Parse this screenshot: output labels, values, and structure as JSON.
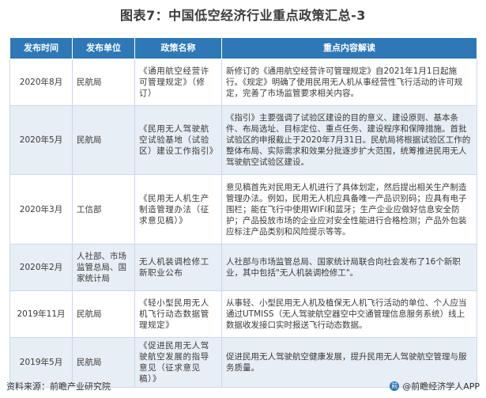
{
  "title": "图表7：中国低空经济行业重点政策汇总-3",
  "table": {
    "headers": [
      "发布时间",
      "发布单位",
      "政策名称",
      "重点内容解读"
    ],
    "rows": [
      {
        "date": "2020年8月",
        "unit": "民航局",
        "name": "《通用航空经营许可管理规定》（修订）",
        "content": "新修订的《通用航空经营许可管理规定》自2021年1月1日起施行。《规定》明确了使用民用无人机从事经营性飞行活动的许可规定，完善了市场监管要求相关内容。"
      },
      {
        "date": "2020年5月",
        "unit": "民航局",
        "name": "《民用无人驾驶航空试验基地（试验区）建设工作指引》",
        "content": "《指引》主要强调了试验区建设的目的意义、建设原则、基本条件、布局选址、目标定位、重点任务、建设程序和保障措施。首批试验区的申报截止于2020年7月31日。民航局将根据试验区工作的整体布局、实际需求和效果分批逐步扩大范围，统筹推进民用无人驾驶航空试验区建设。"
      },
      {
        "date": "2020年3月",
        "unit": "工信部",
        "name": "《民用无人机生产制造管理办法（征求意见稿）》",
        "content": "意见稿首先对民用无人机进行了具体划定，然后提出相关生产制造管理办法。例如，民用无人机应具备唯一产品识别码；应具有电子围栏；能在飞行中使用WIFI和蓝牙；生产企业应做好信息安全防护；产品投放市场的企业应对安全性能进行合格检测；产品外包装应标注产品类别和风险提示等等。"
      },
      {
        "date": "2020年2月",
        "unit": "人社部、市场监管总局、国家统计局",
        "name": "无人机装调检修工新职业公布",
        "content": "人社部与市场监管总局、国家统计局联合向社会发布了16个新职业，其中包括\"无人机装调检修工\"。"
      },
      {
        "date": "2019年11月",
        "unit": "民航局",
        "name": "《轻小型民用无人机飞行动态数据管理规定》",
        "content": "从事轻、小型民用无人机及植保无人机飞行活动的单位、个人应当通过UTMISS（无人驾驶航空器空中交通管理信息服务系统）线上数据收发接口实时报送飞行动态数据。"
      },
      {
        "date": "2019年5月",
        "unit": "民航局",
        "name": "《促进民用无人驾驶航空发展的指导意见（征求意见稿）》",
        "content": "促进民用无人驾驶航空健康发展，提升民用无人驾驶航空管理与服务质量。"
      }
    ]
  },
  "footer": {
    "source": "资料来源：前瞻产业研究院",
    "brand": "@前瞻经济学人APP",
    "brand_logo": "前"
  },
  "watermark": "前瞻产业研究院",
  "colors": {
    "header_bg": "#2e78b7",
    "row_alt_bg": "#e8eef5",
    "border": "#c9d9ea"
  }
}
